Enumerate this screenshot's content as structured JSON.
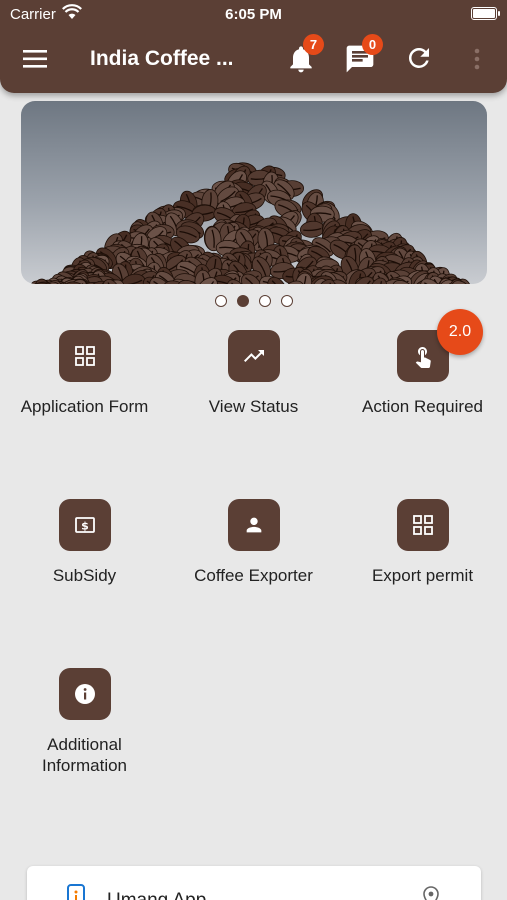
{
  "status_bar": {
    "carrier": "Carrier",
    "time": "6:05 PM"
  },
  "toolbar": {
    "title": "India Coffee ...",
    "notifications_count": "7",
    "messages_count": "0"
  },
  "banner": {
    "slides": 4,
    "active_slide": 2
  },
  "tiles": [
    {
      "label": "Application Form",
      "icon": "grid-icon"
    },
    {
      "label": "View Status",
      "icon": "trending-up-icon"
    },
    {
      "label": "Action Required",
      "icon": "touch-icon"
    },
    {
      "label": "SubSidy",
      "icon": "money-icon"
    },
    {
      "label": "Coffee Exporter",
      "icon": "person-icon"
    },
    {
      "label": "Export permit",
      "icon": "grid-icon"
    },
    {
      "label": "Additional\nInformation",
      "icon": "info-icon"
    }
  ],
  "version_badge": "2.0",
  "bottom_card": {
    "label": "Umang App"
  },
  "colors": {
    "primary": "#5b3f35",
    "accent": "#e64a19",
    "background": "#e8e8e8"
  }
}
